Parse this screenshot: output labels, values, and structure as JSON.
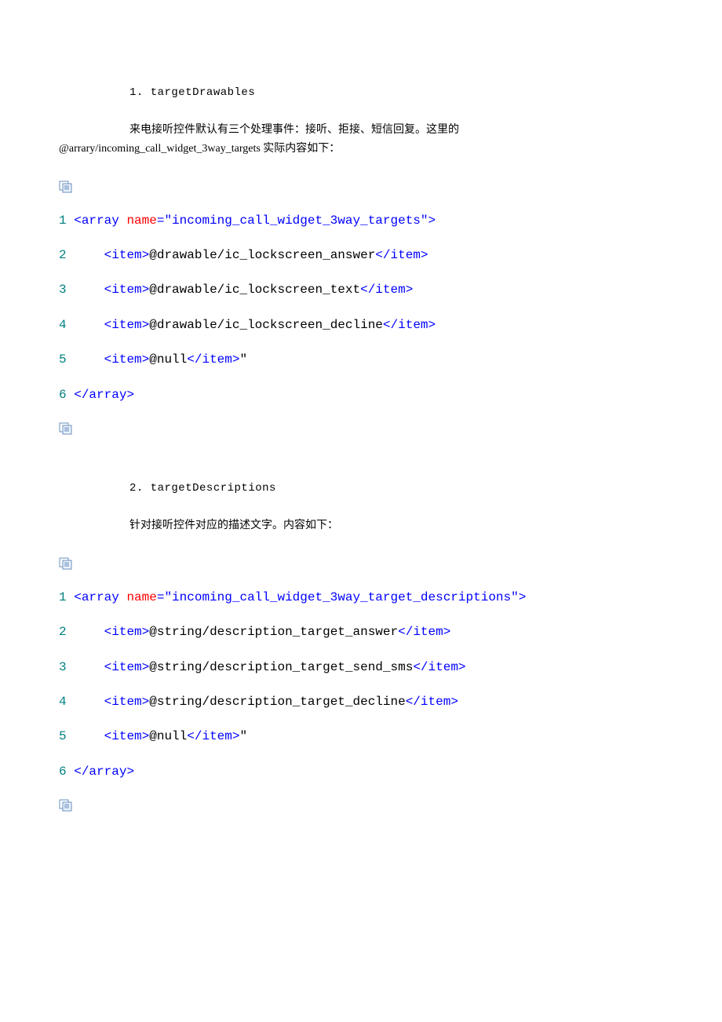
{
  "section1": {
    "heading": "1. targetDrawables",
    "para1": "来电接听控件默认有三个处理事件：接听、拒接、短信回复。这里的",
    "para2": "@arrary/incoming_call_widget_3way_targets 实际内容如下："
  },
  "code1": {
    "ln1": "1",
    "l1_open": "<",
    "l1_tag": "array ",
    "l1_attr": "name",
    "l1_eq": "=\"",
    "l1_val": "incoming_call_widget_3way_targets",
    "l1_endq": "\"",
    "l1_close": ">",
    "ln2": "2",
    "l2_open": "<",
    "l2_tag": "item",
    "l2_gt": ">",
    "l2_txt": "@drawable/ic_lockscreen_answer",
    "l2_co": "</",
    "l2_ctag": "item",
    "l2_cgt": ">",
    "ln3": "3",
    "l3_txt": "@drawable/ic_lockscreen_text",
    "ln4": "4",
    "l4_txt": "@drawable/ic_lockscreen_decline",
    "ln5": "5",
    "l5_txt": "@null",
    "l5_trail": "\"",
    "ln6": "6",
    "l6_co": "</",
    "l6_tag": "array",
    "l6_gt": ">"
  },
  "section2": {
    "heading": "2. targetDescriptions",
    "para": "针对接听控件对应的描述文字。内容如下："
  },
  "code2": {
    "ln1": "1",
    "l1_val": "incoming_call_widget_3way_target_descriptions",
    "ln2": "2",
    "l2_txt": "@string/description_target_answer",
    "ln3": "3",
    "l3_txt": "@string/description_target_send_sms",
    "ln4": "4",
    "l4_txt": "@string/description_target_decline",
    "ln5": "5",
    "l5_txt": "@null",
    "l5_trail": "\"",
    "ln6": "6"
  }
}
